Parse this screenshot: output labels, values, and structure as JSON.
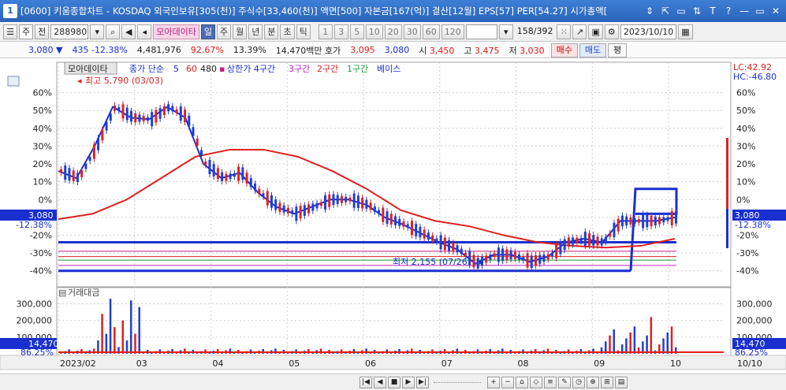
{
  "window": {
    "number": "1",
    "title": "[0600] 키움종합차트 - KOSDAQ 외국인보유[305(천)] 주식수[33,460(천)] 액면[500] 자본금[167(억)] 결산[12월] EPS[57] PER[54.27] 시가총액[",
    "buttons": [
      "⇕",
      "⇱",
      "▭",
      "⇅",
      "T",
      "?",
      "—",
      "▭",
      "✕"
    ]
  },
  "toolbar": {
    "market": "주",
    "all": "전",
    "code": "288980",
    "stock_name": "모아데이타",
    "periods": [
      "일",
      "주",
      "월",
      "년",
      "분",
      "초",
      "틱"
    ],
    "active_period": "일",
    "minutes": [
      "1",
      "3",
      "5",
      "10",
      "20",
      "30",
      "60",
      "120"
    ],
    "count": "158",
    "total": "/392",
    "date": "2023/10/10"
  },
  "quote": {
    "price": "3,080",
    "change": "435",
    "change_pct": "-12.38%",
    "volume": "4,481,976",
    "vol_ratio": "92.67%",
    "turnover": "13.39%",
    "amount": "14,470백만",
    "hoga_label": "호가",
    "hoga1": "3,095",
    "hoga2": "3,080",
    "open_label": "시",
    "open": "3,450",
    "high_label": "고",
    "high": "3,475",
    "low_label": "저",
    "low": "3,030",
    "buy_label": "매수",
    "sell_label": "매도",
    "eval_label": "평"
  },
  "legend": {
    "name": "모아데이타",
    "ma_label": "종가 단순",
    "ma_values": [
      "5",
      "60",
      "480"
    ],
    "zone_labels": [
      "상한가 4구간",
      "3구간",
      "2구간",
      "1구간",
      "베이스"
    ],
    "volume_pane_label": "거래대금"
  },
  "annotations": {
    "high": "최고 5,790 (03/03)",
    "low": "최저 2,155 (07/26)",
    "lc": "LC:42.92",
    "hc": "HC:-46.80",
    "price_tag": "3,080",
    "price_pct": "-12.38%",
    "vol_tag": "14,470",
    "vol_pct": "86.25%",
    "date_right": "10/10"
  },
  "axes": {
    "price_ticks": [
      "60%",
      "50%",
      "40%",
      "30%",
      "20%",
      "10%",
      "0%",
      "-10%",
      "-20%",
      "-30%",
      "-40%"
    ],
    "price_tick_values": [
      60,
      50,
      40,
      30,
      20,
      10,
      0,
      -10,
      -20,
      -30,
      -40
    ],
    "volume_ticks": [
      "300,000",
      "200,000",
      "100,000"
    ],
    "volume_tick_values": [
      300000,
      200000,
      100000
    ],
    "months": [
      "2023/02",
      "03",
      "04",
      "05",
      "06",
      "07",
      "08",
      "09",
      "10"
    ]
  },
  "chart_data": {
    "type": "line",
    "x_labels": [
      "2023/02",
      "03",
      "04",
      "05",
      "06",
      "07",
      "08",
      "09",
      "10"
    ],
    "price_pct_range": [
      -45,
      70
    ],
    "ma5_pct": [
      16,
      12,
      30,
      52,
      46,
      45,
      52,
      46,
      20,
      12,
      15,
      4,
      -4,
      -8,
      -4,
      0,
      0,
      -3,
      -10,
      -14,
      -19,
      -24,
      -28,
      -36,
      -31,
      -31,
      -35,
      -32,
      -24,
      -22,
      -24,
      -12,
      -12,
      -12,
      -10
    ],
    "ma60_pct": [
      -11,
      -8,
      0,
      12,
      24,
      28,
      28,
      24,
      16,
      6,
      -6,
      -12,
      -15,
      -20,
      -24,
      -26,
      -27,
      -26,
      -22
    ],
    "zones_pct": [
      -24,
      -29,
      -32,
      -34,
      -37,
      -40
    ],
    "highlight_box": {
      "period": "09/25-10/10",
      "range_pct": [
        -8,
        6
      ]
    },
    "colors": {
      "up": "#e02020",
      "down": "#2040d0",
      "ma5": "#1a2fd0",
      "ma60": "#e02020",
      "zone": "#1a2fd0"
    }
  }
}
